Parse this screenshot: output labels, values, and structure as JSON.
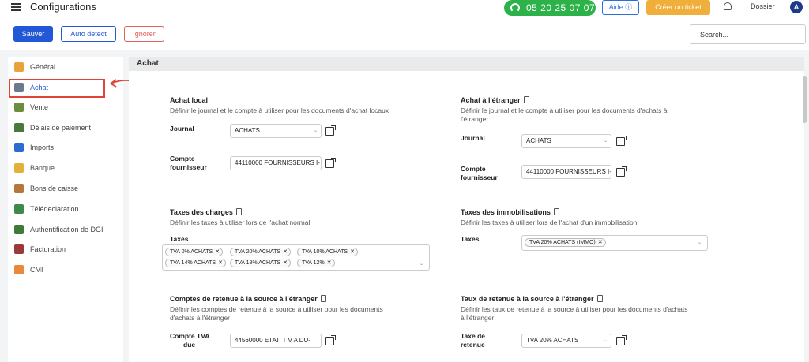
{
  "header": {
    "title": "Configurations",
    "phone": "05 20 25 07 07",
    "aide_label": "Aide ⓘ",
    "ticket_label": "Créer un ticket",
    "dossier_label": "Dossier",
    "avatar_initial": "A"
  },
  "toolbar": {
    "save_label": "Sauver",
    "auto_label": "Auto detect",
    "ignore_label": "Ignorer",
    "search_placeholder": "Search..."
  },
  "sidebar": {
    "items": [
      {
        "label": "Général",
        "color": "#e8a33d"
      },
      {
        "label": "Achat",
        "color": "#6b7b8c"
      },
      {
        "label": "Vente",
        "color": "#6b8e3d"
      },
      {
        "label": "Délais de paiement",
        "color": "#4a7a3a"
      },
      {
        "label": "Imports",
        "color": "#2b6cd1"
      },
      {
        "label": "Banque",
        "color": "#e3b13b"
      },
      {
        "label": "Bons de caisse",
        "color": "#b7773a"
      },
      {
        "label": "Télédeclaration",
        "color": "#3f8a4a"
      },
      {
        "label": "Authentification de DGI",
        "color": "#3f7a3a"
      },
      {
        "label": "Facturation",
        "color": "#9b3a3a"
      },
      {
        "label": "CMI",
        "color": "#e8893d"
      }
    ],
    "active_index": 1
  },
  "main": {
    "section_title": "Achat",
    "achat_local": {
      "title": "Achat local",
      "desc": "Définir le journal et le compte à utiliser pour les documents d'achat locaux",
      "journal_label": "Journal",
      "journal_value": "ACHATS",
      "compte_label_1": "Compte",
      "compte_label_2": "fournisseur",
      "compte_value": "44110000 FOURNISSEURS I-"
    },
    "achat_etranger": {
      "title": "Achat à l'étranger",
      "desc_1": "Définir le journal et le compte à utiliser pour les documents d'achats à",
      "desc_2": "l'étranger",
      "journal_label": "Journal",
      "journal_value": "ACHATS",
      "compte_label_1": "Compte",
      "compte_label_2": "fournisseur",
      "compte_value": "44110000 FOURNISSEURS I-"
    },
    "taxes_charges": {
      "title": "Taxes des charges",
      "desc": "Définir les taxes à utiliser lors de l'achat normal",
      "label": "Taxes",
      "tags": [
        "TVA 0% ACHATS",
        "TVA 20% ACHATS",
        "TVA 10% ACHATS",
        "TVA 14% ACHATS",
        "TVA 18% ACHATS",
        "TVA 12%"
      ]
    },
    "taxes_immob": {
      "title": "Taxes des immobilisations",
      "desc": "Définir les taxes à utiliser lors de l'achat d'un immobilisation.",
      "label": "Taxes",
      "tags": [
        "TVA 20% ACHATS (IMMO)"
      ]
    },
    "comptes_retenue": {
      "title": "Comptes de retenue à la source à l'étranger",
      "desc_1": "Définir les comptes de retenue à la source à utiliser pour les documents",
      "desc_2": "d'achats à l'étranger",
      "label_1": "Compte TVA",
      "label_2": "due",
      "value": "44560000 ETAT, T V A DU-"
    },
    "taux_retenue": {
      "title": "Taux de retenue à la source à l'étranger",
      "desc_1": "Définir les taux de retenue à la source à utiliser pour les documents d'achats",
      "desc_2": "à l'étranger",
      "label_1": "Taxe de",
      "label_2": "retenue",
      "value": "TVA 20% ACHATS"
    }
  },
  "colors": {
    "primary": "#2257d6",
    "phone_green": "#2db24a",
    "ticket_orange": "#f0ae3a",
    "ignore_red": "#e0625c",
    "highlight_red": "#e0433a"
  },
  "icons": [
    "menu-icon",
    "headset-icon",
    "bell-icon",
    "document-icon",
    "external-link-icon",
    "chevron-down-icon",
    "remove-tag-icon"
  ]
}
